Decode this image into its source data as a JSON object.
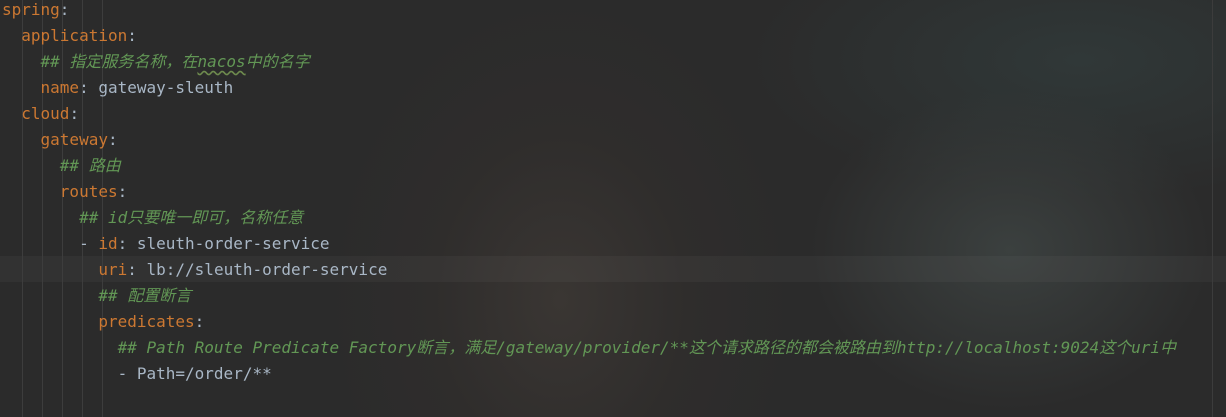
{
  "theme": {
    "background": "#2b2b2b",
    "key_color": "#cc7832",
    "value_color": "#a9b7c6",
    "comment_color": "#629755"
  },
  "lines": [
    {
      "key": "spring",
      "sep": ":"
    },
    {
      "key": "application",
      "sep": ":"
    },
    {
      "comment_a": "## 指定服务名称，在",
      "comment_u": "nacos",
      "comment_b": "中的名字"
    },
    {
      "key": "name",
      "sep": ":",
      "value": " gateway-sleuth"
    },
    {
      "key": "cloud",
      "sep": ":"
    },
    {
      "key": "gateway",
      "sep": ":"
    },
    {
      "comment": "## 路由"
    },
    {
      "key": "routes",
      "sep": ":"
    },
    {
      "comment": "## id只要唯一即可，名称任意"
    },
    {
      "dash": "- ",
      "key": "id",
      "sep": ":",
      "value": " sleuth-order-service"
    },
    {
      "key": "uri",
      "sep": ":",
      "value": " lb://sleuth-order-service"
    },
    {
      "comment": "## 配置断言"
    },
    {
      "key": "predicates",
      "sep": ":"
    },
    {
      "comment": "## Path Route Predicate Factory断言，满足/gateway/provider/**这个请求路径的都会被路由到http://localhost:9024这个uri中"
    },
    {
      "value": "- Path=/order/**"
    }
  ]
}
